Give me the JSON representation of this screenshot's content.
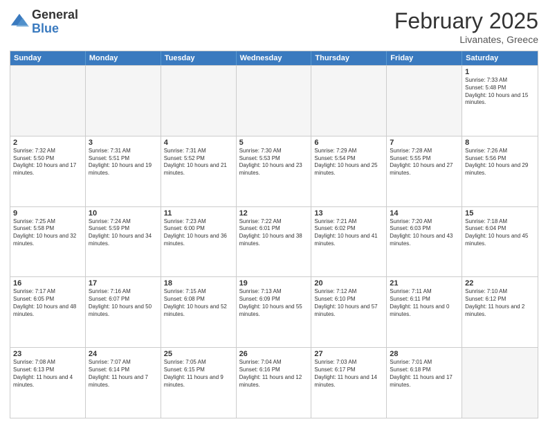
{
  "logo": {
    "general": "General",
    "blue": "Blue"
  },
  "header": {
    "title": "February 2025",
    "subtitle": "Livanates, Greece"
  },
  "weekdays": [
    "Sunday",
    "Monday",
    "Tuesday",
    "Wednesday",
    "Thursday",
    "Friday",
    "Saturday"
  ],
  "weeks": [
    [
      {
        "day": "",
        "empty": true
      },
      {
        "day": "",
        "empty": true
      },
      {
        "day": "",
        "empty": true
      },
      {
        "day": "",
        "empty": true
      },
      {
        "day": "",
        "empty": true
      },
      {
        "day": "",
        "empty": true
      },
      {
        "day": "1",
        "sunrise": "7:33 AM",
        "sunset": "5:48 PM",
        "daylight": "10 hours and 15 minutes."
      }
    ],
    [
      {
        "day": "2",
        "sunrise": "7:32 AM",
        "sunset": "5:50 PM",
        "daylight": "10 hours and 17 minutes."
      },
      {
        "day": "3",
        "sunrise": "7:31 AM",
        "sunset": "5:51 PM",
        "daylight": "10 hours and 19 minutes."
      },
      {
        "day": "4",
        "sunrise": "7:31 AM",
        "sunset": "5:52 PM",
        "daylight": "10 hours and 21 minutes."
      },
      {
        "day": "5",
        "sunrise": "7:30 AM",
        "sunset": "5:53 PM",
        "daylight": "10 hours and 23 minutes."
      },
      {
        "day": "6",
        "sunrise": "7:29 AM",
        "sunset": "5:54 PM",
        "daylight": "10 hours and 25 minutes."
      },
      {
        "day": "7",
        "sunrise": "7:28 AM",
        "sunset": "5:55 PM",
        "daylight": "10 hours and 27 minutes."
      },
      {
        "day": "8",
        "sunrise": "7:26 AM",
        "sunset": "5:56 PM",
        "daylight": "10 hours and 29 minutes."
      }
    ],
    [
      {
        "day": "9",
        "sunrise": "7:25 AM",
        "sunset": "5:58 PM",
        "daylight": "10 hours and 32 minutes."
      },
      {
        "day": "10",
        "sunrise": "7:24 AM",
        "sunset": "5:59 PM",
        "daylight": "10 hours and 34 minutes."
      },
      {
        "day": "11",
        "sunrise": "7:23 AM",
        "sunset": "6:00 PM",
        "daylight": "10 hours and 36 minutes."
      },
      {
        "day": "12",
        "sunrise": "7:22 AM",
        "sunset": "6:01 PM",
        "daylight": "10 hours and 38 minutes."
      },
      {
        "day": "13",
        "sunrise": "7:21 AM",
        "sunset": "6:02 PM",
        "daylight": "10 hours and 41 minutes."
      },
      {
        "day": "14",
        "sunrise": "7:20 AM",
        "sunset": "6:03 PM",
        "daylight": "10 hours and 43 minutes."
      },
      {
        "day": "15",
        "sunrise": "7:18 AM",
        "sunset": "6:04 PM",
        "daylight": "10 hours and 45 minutes."
      }
    ],
    [
      {
        "day": "16",
        "sunrise": "7:17 AM",
        "sunset": "6:05 PM",
        "daylight": "10 hours and 48 minutes."
      },
      {
        "day": "17",
        "sunrise": "7:16 AM",
        "sunset": "6:07 PM",
        "daylight": "10 hours and 50 minutes."
      },
      {
        "day": "18",
        "sunrise": "7:15 AM",
        "sunset": "6:08 PM",
        "daylight": "10 hours and 52 minutes."
      },
      {
        "day": "19",
        "sunrise": "7:13 AM",
        "sunset": "6:09 PM",
        "daylight": "10 hours and 55 minutes."
      },
      {
        "day": "20",
        "sunrise": "7:12 AM",
        "sunset": "6:10 PM",
        "daylight": "10 hours and 57 minutes."
      },
      {
        "day": "21",
        "sunrise": "7:11 AM",
        "sunset": "6:11 PM",
        "daylight": "11 hours and 0 minutes."
      },
      {
        "day": "22",
        "sunrise": "7:10 AM",
        "sunset": "6:12 PM",
        "daylight": "11 hours and 2 minutes."
      }
    ],
    [
      {
        "day": "23",
        "sunrise": "7:08 AM",
        "sunset": "6:13 PM",
        "daylight": "11 hours and 4 minutes."
      },
      {
        "day": "24",
        "sunrise": "7:07 AM",
        "sunset": "6:14 PM",
        "daylight": "11 hours and 7 minutes."
      },
      {
        "day": "25",
        "sunrise": "7:05 AM",
        "sunset": "6:15 PM",
        "daylight": "11 hours and 9 minutes."
      },
      {
        "day": "26",
        "sunrise": "7:04 AM",
        "sunset": "6:16 PM",
        "daylight": "11 hours and 12 minutes."
      },
      {
        "day": "27",
        "sunrise": "7:03 AM",
        "sunset": "6:17 PM",
        "daylight": "11 hours and 14 minutes."
      },
      {
        "day": "28",
        "sunrise": "7:01 AM",
        "sunset": "6:18 PM",
        "daylight": "11 hours and 17 minutes."
      },
      {
        "day": "",
        "empty": true
      }
    ]
  ]
}
